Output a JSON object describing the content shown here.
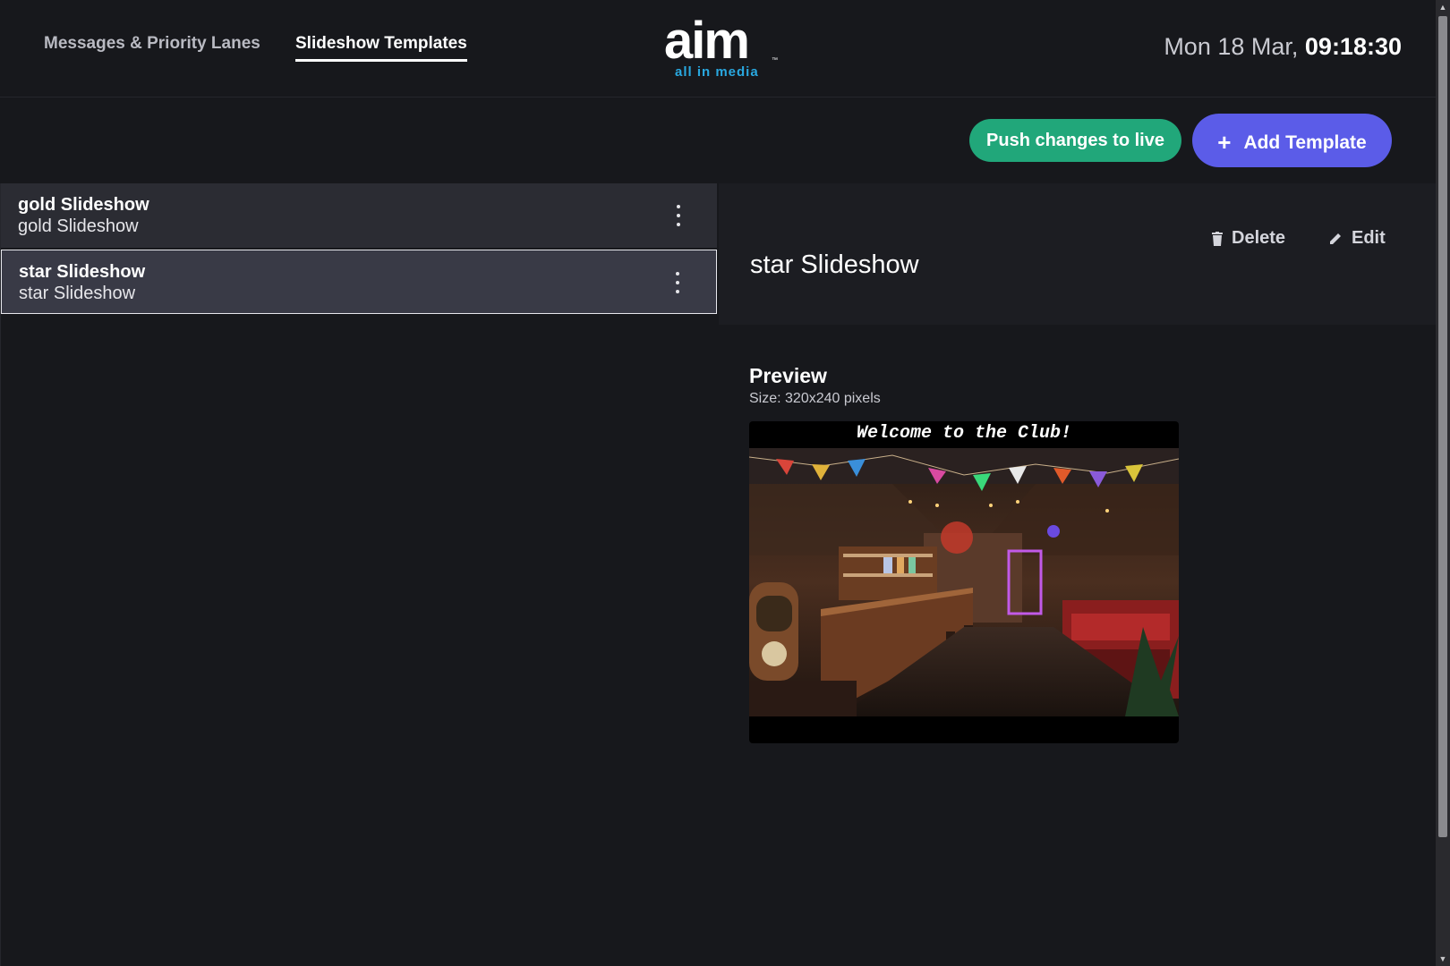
{
  "nav": {
    "tabs": [
      {
        "label": "Messages & Priority Lanes",
        "active": false
      },
      {
        "label": "Slideshow Templates",
        "active": true
      }
    ]
  },
  "logo": {
    "word": "aim",
    "tm": "™",
    "subtitle": "all in media"
  },
  "clock": {
    "date": "Mon 18 Mar,",
    "time": "09:18:30"
  },
  "actions": {
    "push_label": "Push changes to live",
    "add_label": "Add Template",
    "add_icon": "+"
  },
  "templates": [
    {
      "title": "gold Slideshow",
      "subtitle": "gold Slideshow",
      "selected": false
    },
    {
      "title": "star Slideshow",
      "subtitle": "star Slideshow",
      "selected": true
    }
  ],
  "detail": {
    "title": "star Slideshow",
    "delete_label": "Delete",
    "edit_label": "Edit",
    "preview_title": "Preview",
    "preview_size": "Size: 320x240 pixels",
    "preview_caption": "Welcome to the Club!"
  },
  "colors": {
    "background": "#17181c",
    "push_button": "#21a77a",
    "add_button": "#5b5ce8",
    "logo_subtitle": "#29a8e0"
  }
}
